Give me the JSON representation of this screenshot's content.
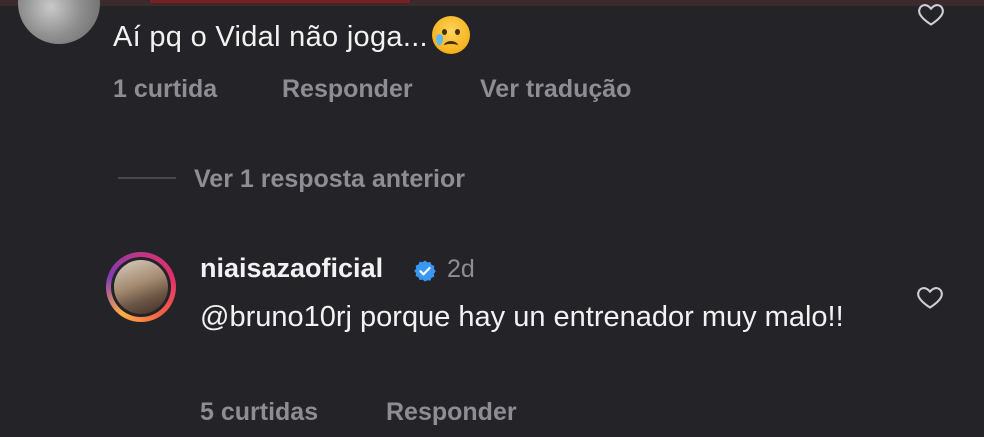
{
  "comment1": {
    "text": "Aí pq o Vidal não joga...",
    "emoji": "crying-face",
    "likes": "1 curtida",
    "reply_label": "Responder",
    "translate_label": "Ver tradução"
  },
  "thread": {
    "view_previous_label": "Ver 1 resposta anterior"
  },
  "comment2": {
    "username": "niaisazaoficial",
    "time": "2d",
    "text": "@bruno10rj porque hay un entrenador muy malo!!",
    "likes": "5 curtidas",
    "reply_label": "Responder"
  },
  "colors": {
    "background": "#242328",
    "muted_text": "#8e8d93",
    "verified_blue": "#3897f0"
  }
}
